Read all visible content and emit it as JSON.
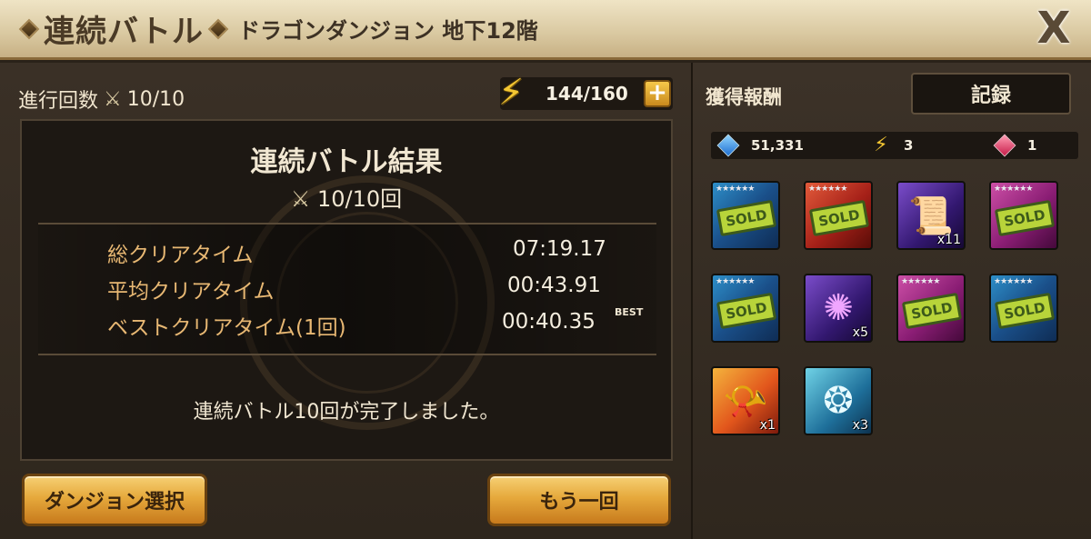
{
  "header": {
    "title": "連続バトル",
    "subtitle": "ドラゴンダンジョン 地下12階",
    "close_label": "X"
  },
  "progress": {
    "label": "進行回数",
    "value": "10/10"
  },
  "energy": {
    "value": "144/160",
    "plus_label": "+"
  },
  "result": {
    "title": "連続バトル結果",
    "count": "10/10回",
    "stats": [
      {
        "label": "総クリアタイム",
        "value": "07:19.17"
      },
      {
        "label": "平均クリアタイム",
        "value": "00:43.91"
      },
      {
        "label": "ベストクリアタイム(1回)",
        "value": "00:40.35"
      }
    ],
    "best_tag": "BEST",
    "message": "連続バトル10回が完了しました。"
  },
  "buttons": {
    "select_dungeon": "ダンジョン選択",
    "retry": "もう一回"
  },
  "rewards": {
    "title": "獲得報酬",
    "record_label": "記録",
    "currency": {
      "crystal": "51,331",
      "energy": "3",
      "ruby": "1"
    },
    "items": [
      {
        "kind": "rune-sold",
        "stars": "★★★★★★",
        "label": "SOLD",
        "qty": ""
      },
      {
        "kind": "rune-sold",
        "stars": "★★★★★★",
        "label": "SOLD",
        "qty": ""
      },
      {
        "kind": "mystic-scroll",
        "stars": "",
        "label": "",
        "qty": "x11"
      },
      {
        "kind": "rune-sold",
        "stars": "★★★★★★",
        "label": "SOLD",
        "qty": ""
      },
      {
        "kind": "rune-sold",
        "stars": "★★★★★★",
        "label": "SOLD",
        "qty": ""
      },
      {
        "kind": "magic-essence",
        "stars": "",
        "label": "",
        "qty": "x5"
      },
      {
        "kind": "rune-sold",
        "stars": "★★★★★★",
        "label": "SOLD",
        "qty": ""
      },
      {
        "kind": "rune-sold",
        "stars": "★★★★★★",
        "label": "SOLD",
        "qty": ""
      },
      {
        "kind": "fire-scroll",
        "stars": "",
        "label": "",
        "qty": "x1"
      },
      {
        "kind": "wind-essence",
        "stars": "",
        "label": "",
        "qty": "x3"
      }
    ]
  }
}
